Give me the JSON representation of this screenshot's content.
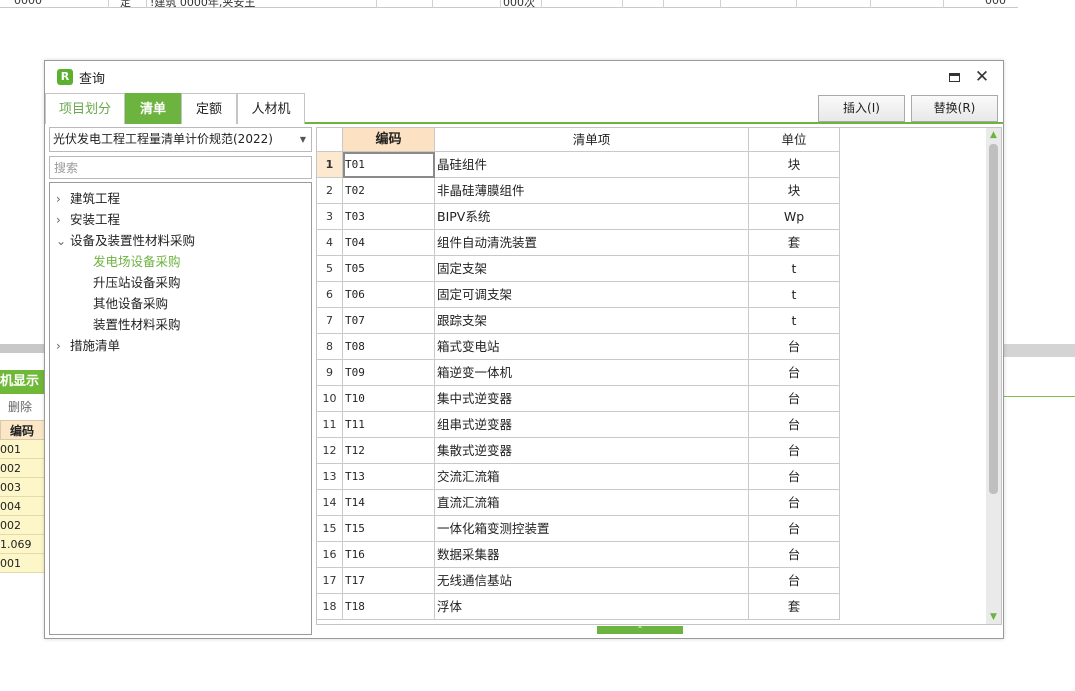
{
  "background": {
    "top_row": [
      "0000",
      "定",
      "!建筑 0000年,夹安王",
      "000次",
      "000"
    ],
    "panel_title": "机显示",
    "panel_delete": "删除",
    "panel_header": "编码",
    "panel_codes": [
      "001",
      "002",
      "003",
      "004",
      "002",
      "1.069",
      "001"
    ]
  },
  "dialog": {
    "title": "查询",
    "app_icon": "R",
    "maximize_icon": "maximize-icon",
    "close_icon": "✕"
  },
  "tabs": [
    {
      "label": "项目划分"
    },
    {
      "label": "清单"
    },
    {
      "label": "定额"
    },
    {
      "label": "人材机"
    }
  ],
  "actions": {
    "insert": "插入(I)",
    "replace": "替换(R)"
  },
  "left": {
    "spec_selected": "光伏发电工程工程量清单计价规范(2022)",
    "search_placeholder": "搜索",
    "tree": [
      {
        "label": "建筑工程",
        "chev": "›"
      },
      {
        "label": "安装工程",
        "chev": "›"
      },
      {
        "label": "设备及装置性材料采购",
        "chev": "⌄"
      },
      {
        "label": "发电场设备采购",
        "chev": ""
      },
      {
        "label": "升压站设备采购",
        "chev": ""
      },
      {
        "label": "其他设备采购",
        "chev": ""
      },
      {
        "label": "装置性材料采购",
        "chev": ""
      },
      {
        "label": "措施清单",
        "chev": "›"
      }
    ]
  },
  "grid": {
    "headers": {
      "code": "编码",
      "item": "清单项",
      "unit": "单位"
    },
    "rows": [
      {
        "num": "1",
        "code": "T01",
        "item": "晶硅组件",
        "unit": "块"
      },
      {
        "num": "2",
        "code": "T02",
        "item": "非晶硅薄膜组件",
        "unit": "块"
      },
      {
        "num": "3",
        "code": "T03",
        "item": "BIPV系统",
        "unit": "Wp"
      },
      {
        "num": "4",
        "code": "T04",
        "item": "组件自动清洗装置",
        "unit": "套"
      },
      {
        "num": "5",
        "code": "T05",
        "item": "固定支架",
        "unit": "t"
      },
      {
        "num": "6",
        "code": "T06",
        "item": "固定可调支架",
        "unit": "t"
      },
      {
        "num": "7",
        "code": "T07",
        "item": "跟踪支架",
        "unit": "t"
      },
      {
        "num": "8",
        "code": "T08",
        "item": "箱式变电站",
        "unit": "台"
      },
      {
        "num": "9",
        "code": "T09",
        "item": "箱逆变一体机",
        "unit": "台"
      },
      {
        "num": "10",
        "code": "T10",
        "item": "集中式逆变器",
        "unit": "台"
      },
      {
        "num": "11",
        "code": "T11",
        "item": "组串式逆变器",
        "unit": "台"
      },
      {
        "num": "12",
        "code": "T12",
        "item": "集散式逆变器",
        "unit": "台"
      },
      {
        "num": "13",
        "code": "T13",
        "item": "交流汇流箱",
        "unit": "台"
      },
      {
        "num": "14",
        "code": "T14",
        "item": "直流汇流箱",
        "unit": "台"
      },
      {
        "num": "15",
        "code": "T15",
        "item": "一体化箱变测控装置",
        "unit": "台"
      },
      {
        "num": "16",
        "code": "T16",
        "item": "数据采集器",
        "unit": "台"
      },
      {
        "num": "17",
        "code": "T17",
        "item": "无线通信基站",
        "unit": "台"
      },
      {
        "num": "18",
        "code": "T18",
        "item": "浮体",
        "unit": "套"
      }
    ]
  }
}
